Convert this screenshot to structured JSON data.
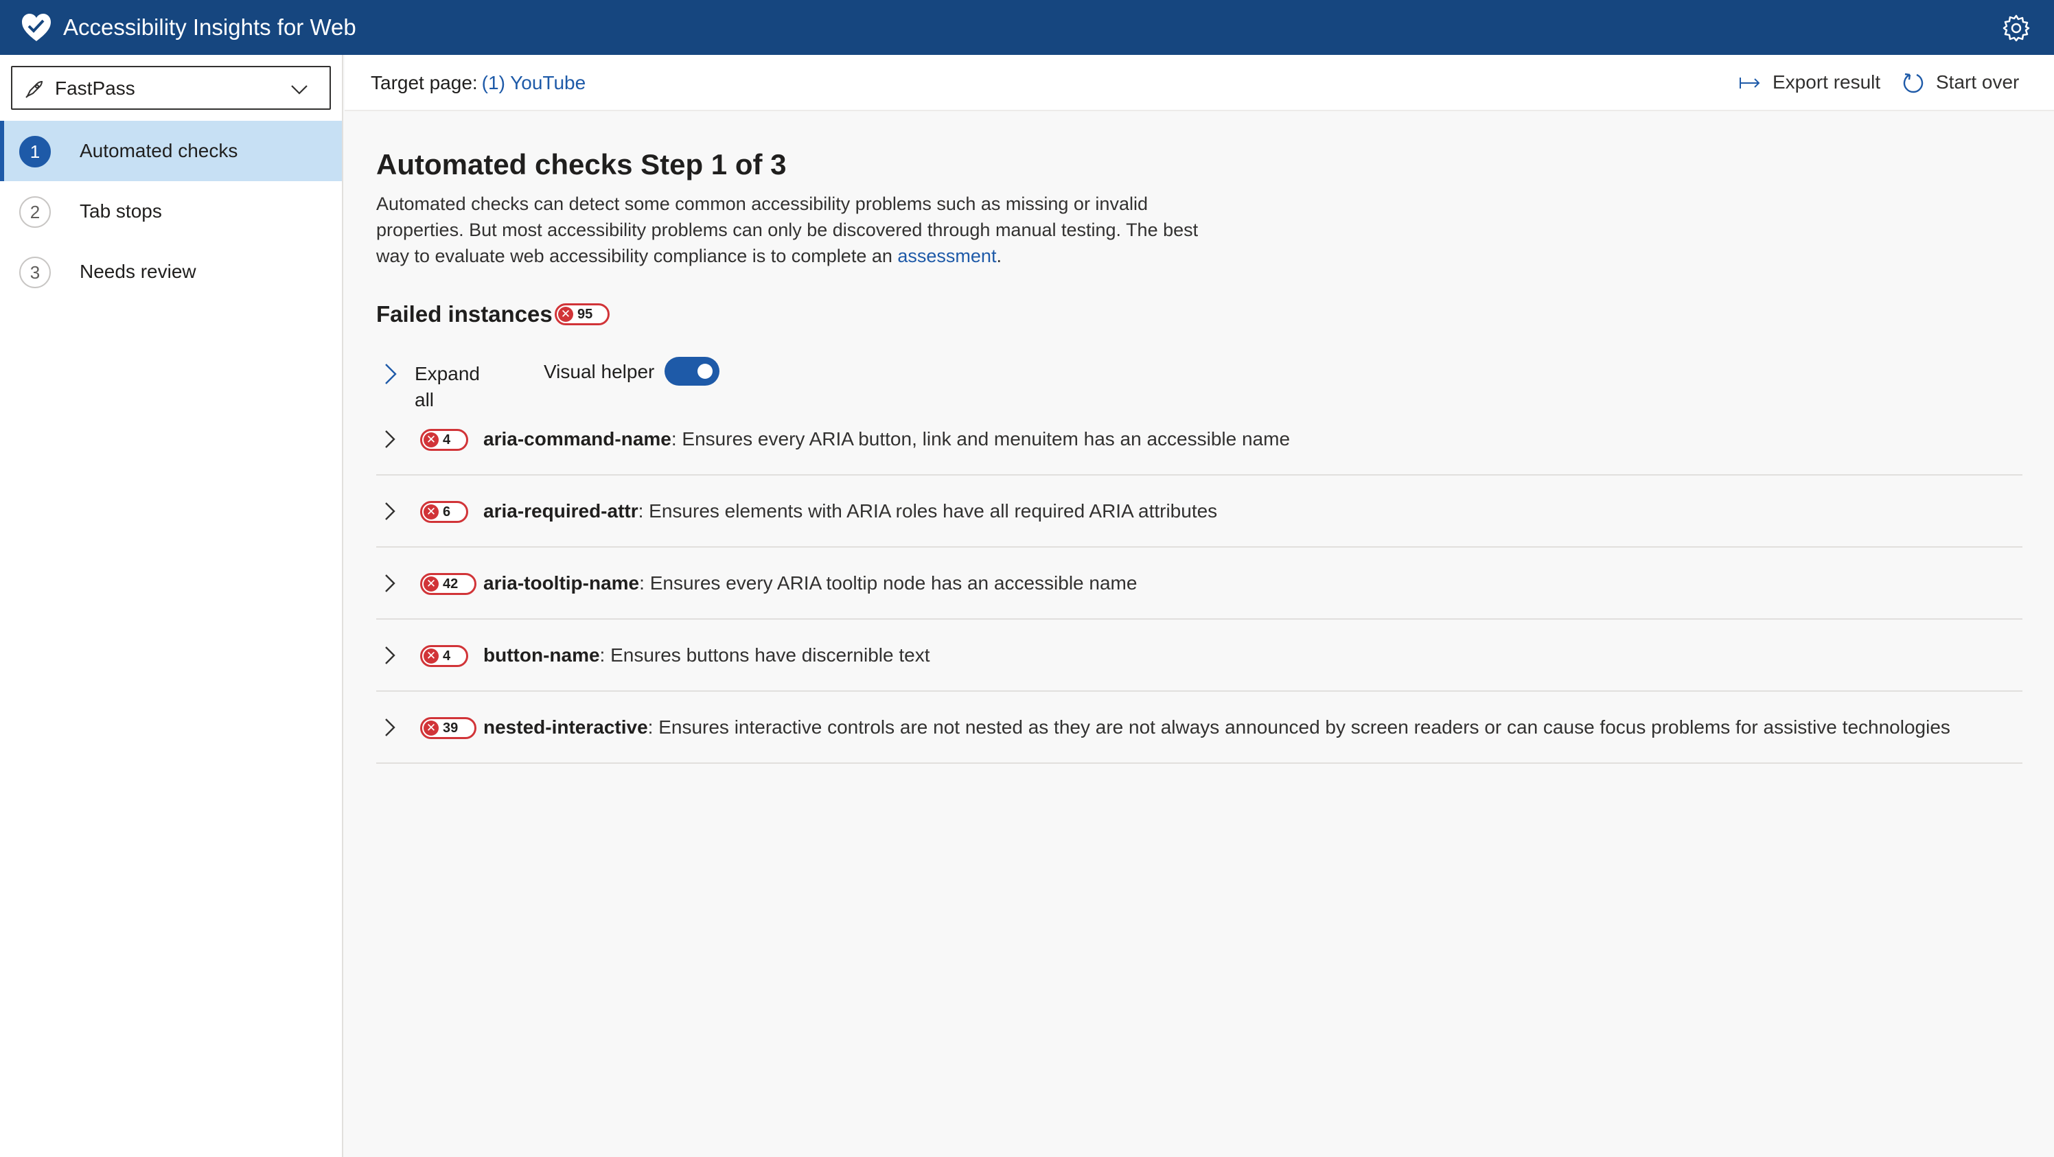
{
  "app": {
    "title": "Accessibility Insights for Web",
    "logo_icon": "heart-logo-icon",
    "settings_icon": "gear-icon"
  },
  "sidebar": {
    "mode_select": {
      "value": "FastPass",
      "icon": "rocket-icon"
    },
    "items": [
      {
        "number": "1",
        "label": "Automated checks",
        "selected": true
      },
      {
        "number": "2",
        "label": "Tab stops",
        "selected": false
      },
      {
        "number": "3",
        "label": "Needs review",
        "selected": false
      }
    ]
  },
  "command_bar": {
    "target_label": "Target page:",
    "target_link": "(1) YouTube",
    "export_label": "Export result",
    "start_over_label": "Start over"
  },
  "main": {
    "heading": "Automated checks Step 1 of 3",
    "description": "Automated checks can detect some common accessibility problems such as missing or invalid properties. But most accessibility problems can only be discovered through manual testing. The best way to evaluate web accessibility compliance is to complete an",
    "description_link": "assessment",
    "description_end": ".",
    "failed_title": "Failed instances",
    "failed_count": "95",
    "expand_all_label": "Expand all",
    "visual_helper_label": "Visual helper",
    "visual_helper_on": true,
    "rules": [
      {
        "count": "4",
        "name": "aria-command-name",
        "description": ": Ensures every ARIA button, link and menuitem has an accessible name"
      },
      {
        "count": "6",
        "name": "aria-required-attr",
        "description": ": Ensures elements with ARIA roles have all required ARIA attributes"
      },
      {
        "count": "42",
        "name": "aria-tooltip-name",
        "description": ": Ensures every ARIA tooltip node has an accessible name"
      },
      {
        "count": "4",
        "name": "button-name",
        "description": ": Ensures buttons have discernible text"
      },
      {
        "count": "39",
        "name": "nested-interactive",
        "description": ": Ensures interactive controls are not nested as they are not always announced by screen readers or can cause focus problems for assistive technologies"
      }
    ]
  },
  "colors": {
    "titlebar": "#16467f",
    "accent": "#1e5aa8",
    "selected_nav": "#c7e0f4",
    "error": "#d13438"
  }
}
